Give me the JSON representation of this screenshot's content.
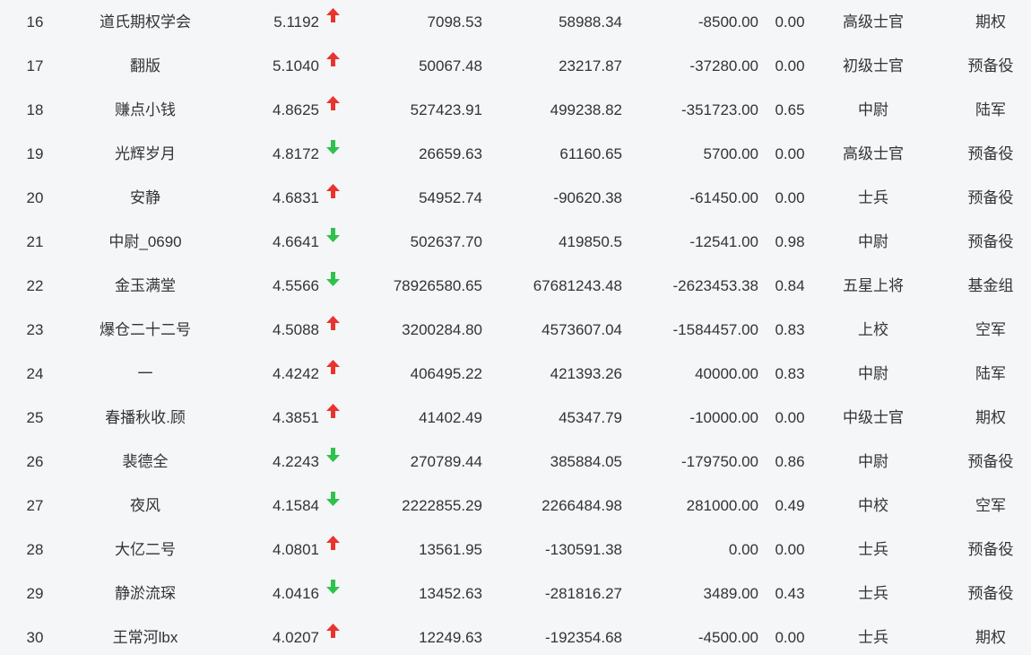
{
  "colors": {
    "up": "#e8342f",
    "down": "#2ec24d",
    "text": "#333333",
    "background": "#f5f6f8"
  },
  "rows": [
    {
      "rank": "16",
      "name": "道氏期权学会",
      "score": "5.1192",
      "trend": "up",
      "trend_icon": "arrow-up-icon",
      "v1": "7098.53",
      "v2": "58988.34",
      "v3": "-8500.00",
      "v4": "0.00",
      "title": "高级士官",
      "group": "期权"
    },
    {
      "rank": "17",
      "name": "翻版",
      "score": "5.1040",
      "trend": "up",
      "trend_icon": "arrow-up-icon",
      "v1": "50067.48",
      "v2": "23217.87",
      "v3": "-37280.00",
      "v4": "0.00",
      "title": "初级士官",
      "group": "预备役"
    },
    {
      "rank": "18",
      "name": "赚点小钱",
      "score": "4.8625",
      "trend": "up",
      "trend_icon": "arrow-up-icon",
      "v1": "527423.91",
      "v2": "499238.82",
      "v3": "-351723.00",
      "v4": "0.65",
      "title": "中尉",
      "group": "陆军"
    },
    {
      "rank": "19",
      "name": "光辉岁月",
      "score": "4.8172",
      "trend": "down",
      "trend_icon": "arrow-down-icon",
      "v1": "26659.63",
      "v2": "61160.65",
      "v3": "5700.00",
      "v4": "0.00",
      "title": "高级士官",
      "group": "预备役"
    },
    {
      "rank": "20",
      "name": "安静",
      "score": "4.6831",
      "trend": "up",
      "trend_icon": "arrow-up-icon",
      "v1": "54952.74",
      "v2": "-90620.38",
      "v3": "-61450.00",
      "v4": "0.00",
      "title": "士兵",
      "group": "预备役"
    },
    {
      "rank": "21",
      "name": "中尉_0690",
      "score": "4.6641",
      "trend": "down",
      "trend_icon": "arrow-down-icon",
      "v1": "502637.70",
      "v2": "419850.5",
      "v3": "-12541.00",
      "v4": "0.98",
      "title": "中尉",
      "group": "预备役"
    },
    {
      "rank": "22",
      "name": "金玉满堂",
      "score": "4.5566",
      "trend": "down",
      "trend_icon": "arrow-down-icon",
      "v1": "78926580.65",
      "v2": "67681243.48",
      "v3": "-2623453.38",
      "v4": "0.84",
      "title": "五星上将",
      "group": "基金组"
    },
    {
      "rank": "23",
      "name": "爆仓二十二号",
      "score": "4.5088",
      "trend": "up",
      "trend_icon": "arrow-up-icon",
      "v1": "3200284.80",
      "v2": "4573607.04",
      "v3": "-1584457.00",
      "v4": "0.83",
      "title": "上校",
      "group": "空军"
    },
    {
      "rank": "24",
      "name": "一",
      "score": "4.4242",
      "trend": "up",
      "trend_icon": "arrow-up-icon",
      "v1": "406495.22",
      "v2": "421393.26",
      "v3": "40000.00",
      "v4": "0.83",
      "title": "中尉",
      "group": "陆军"
    },
    {
      "rank": "25",
      "name": "春播秋收.顾",
      "score": "4.3851",
      "trend": "up",
      "trend_icon": "arrow-up-icon",
      "v1": "41402.49",
      "v2": "45347.79",
      "v3": "-10000.00",
      "v4": "0.00",
      "title": "中级士官",
      "group": "期权"
    },
    {
      "rank": "26",
      "name": "裴德全",
      "score": "4.2243",
      "trend": "down",
      "trend_icon": "arrow-down-icon",
      "v1": "270789.44",
      "v2": "385884.05",
      "v3": "-179750.00",
      "v4": "0.86",
      "title": "中尉",
      "group": "预备役"
    },
    {
      "rank": "27",
      "name": "夜风",
      "score": "4.1584",
      "trend": "down",
      "trend_icon": "arrow-down-icon",
      "v1": "2222855.29",
      "v2": "2266484.98",
      "v3": "281000.00",
      "v4": "0.49",
      "title": "中校",
      "group": "空军"
    },
    {
      "rank": "28",
      "name": "大亿二号",
      "score": "4.0801",
      "trend": "up",
      "trend_icon": "arrow-up-icon",
      "v1": "13561.95",
      "v2": "-130591.38",
      "v3": "0.00",
      "v4": "0.00",
      "title": "士兵",
      "group": "预备役"
    },
    {
      "rank": "29",
      "name": "静淤流琛",
      "score": "4.0416",
      "trend": "down",
      "trend_icon": "arrow-down-icon",
      "v1": "13452.63",
      "v2": "-281816.27",
      "v3": "3489.00",
      "v4": "0.43",
      "title": "士兵",
      "group": "预备役"
    },
    {
      "rank": "30",
      "name": "王常河lbx",
      "score": "4.0207",
      "trend": "up",
      "trend_icon": "arrow-up-icon",
      "v1": "12249.63",
      "v2": "-192354.68",
      "v3": "-4500.00",
      "v4": "0.00",
      "title": "士兵",
      "group": "期权"
    }
  ]
}
